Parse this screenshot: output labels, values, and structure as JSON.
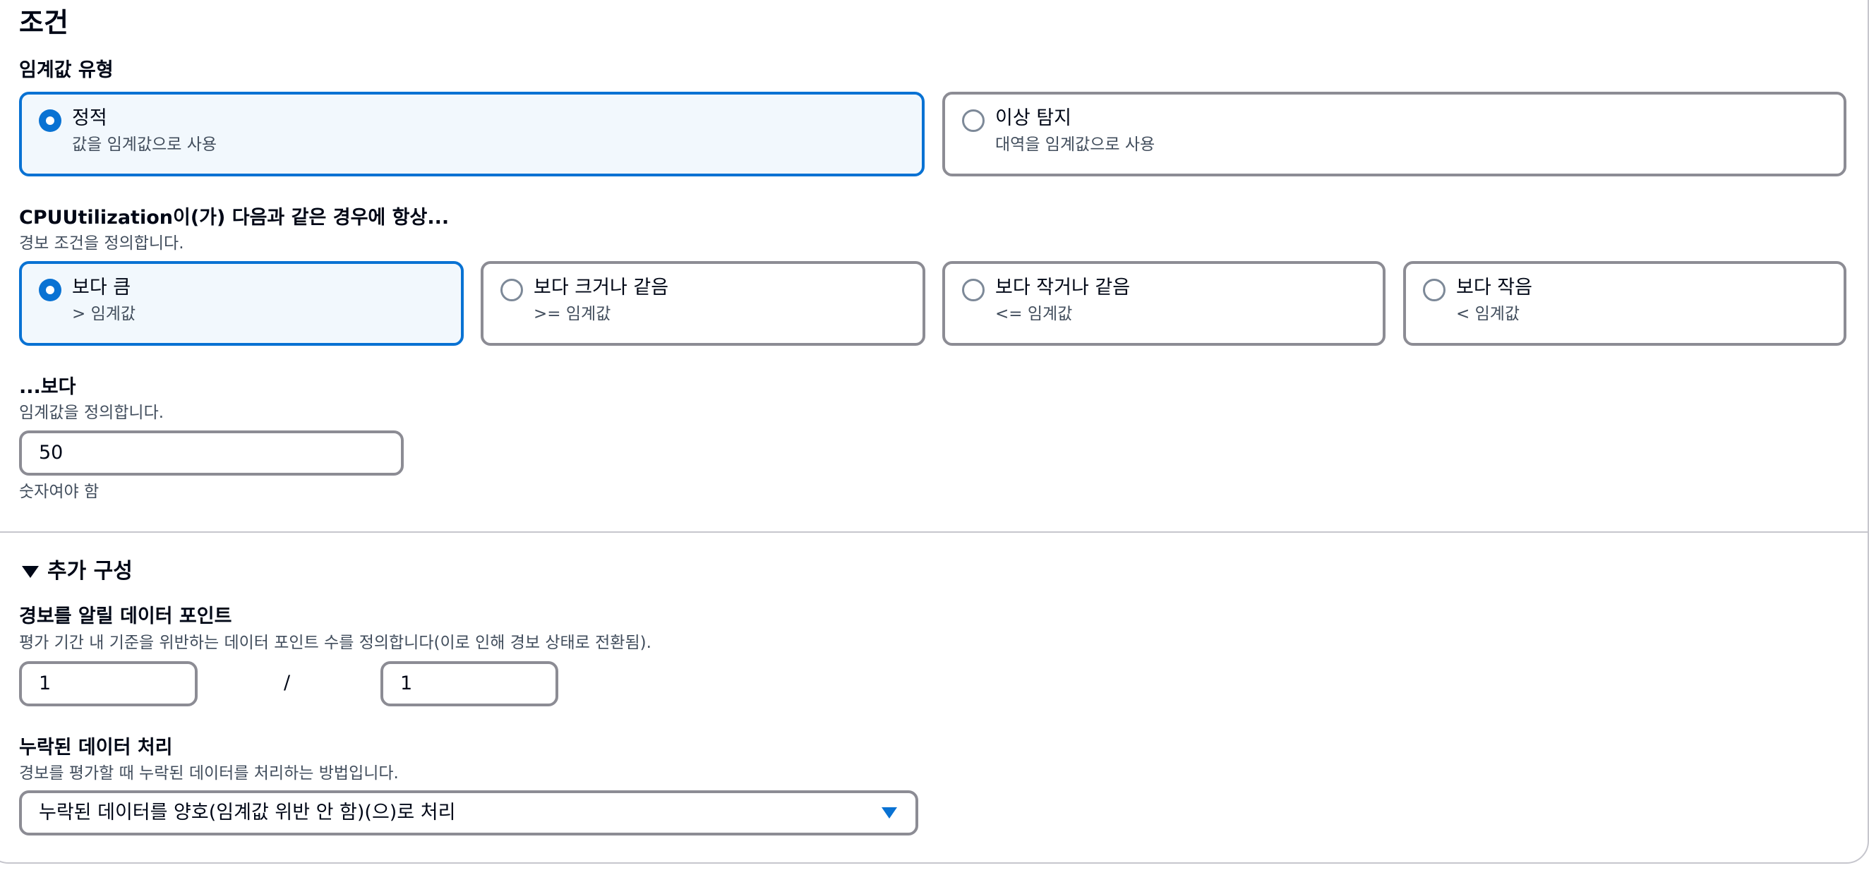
{
  "conditions": {
    "section_title": "조건",
    "threshold_type": {
      "label": "임계값 유형",
      "options": [
        {
          "title": "정적",
          "subtitle": "값을 임계값으로 사용",
          "selected": true
        },
        {
          "title": "이상 탐지",
          "subtitle": "대역을 임계값으로 사용",
          "selected": false
        }
      ]
    },
    "comparison": {
      "label": "CPUUtilization이(가) 다음과 같은 경우에 항상...",
      "description": "경보 조건을 정의합니다.",
      "options": [
        {
          "title": "보다 큼",
          "subtitle": "> 임계값",
          "selected": true
        },
        {
          "title": "보다 크거나 같음",
          "subtitle": ">= 임계값",
          "selected": false
        },
        {
          "title": "보다 작거나 같음",
          "subtitle": "<= 임계값",
          "selected": false
        },
        {
          "title": "보다 작음",
          "subtitle": "< 임계값",
          "selected": false
        }
      ]
    },
    "threshold": {
      "label": "...보다",
      "description": "임계값을 정의합니다.",
      "value": "50",
      "constraint": "숫자여야 함"
    }
  },
  "additional_config": {
    "expander_label": "추가 구성",
    "expanded": true,
    "datapoints": {
      "label": "경보를 알릴 데이터 포인트",
      "description": "평가 기간 내 기준을 위반하는 데이터 포인트 수를 정의합니다(이로 인해 경보 상태로 전환됨).",
      "datapoints_value": "1",
      "separator": "/",
      "evaluation_periods_value": "1"
    },
    "missing_data": {
      "label": "누락된 데이터 처리",
      "description": "경보를 평가할 때 누락된 데이터를 처리하는 방법입니다.",
      "selected": "누락된 데이터를 양호(임계값 위반 안 함)(으)로 처리"
    }
  },
  "colors": {
    "accent": "#0972d3",
    "selected_tile_bg": "#f2f8fd",
    "border": "#8c8c94",
    "text": "#000716",
    "secondary_text": "#414d5c"
  }
}
